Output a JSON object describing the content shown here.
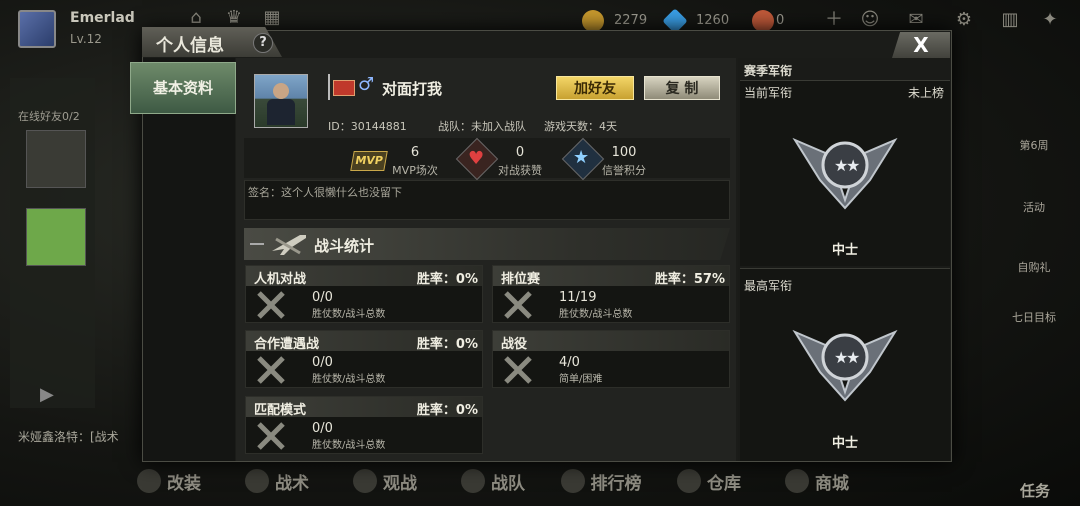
{
  "topbar": {
    "player_name": "Emerlad",
    "level": "Lv.12",
    "currency": [
      {
        "name": "gold",
        "value": "2279",
        "color": "#c99a2e"
      },
      {
        "name": "diamond",
        "value": "1260",
        "color": "#3aa0e8"
      },
      {
        "name": "medal",
        "value": "0",
        "color": "#c25a3a"
      }
    ]
  },
  "left_sidebar": {
    "online_friends": "在线好友0/2"
  },
  "chat": {
    "text": "米娅鑫洛特：[战术"
  },
  "right_sidebar": {
    "items": [
      "第6周",
      "活动",
      "自购礼",
      "七日目标"
    ]
  },
  "bottom_nav": [
    "改装",
    "战术",
    "观战",
    "战队",
    "排行榜",
    "仓库",
    "商城"
  ],
  "task_label": "任务",
  "panel": {
    "title": "个人信息",
    "help": "?",
    "close": "X",
    "tab_basic": "基本资料"
  },
  "profile": {
    "nickname": "对面打我",
    "gender_symbol": "♂",
    "add_friend": "加好友",
    "copy": "复 制",
    "id": "ID：30144881",
    "team": "战队：未加入战队",
    "days": "游戏天数：4天",
    "signature": "签名：这个人很懒什么也没留下"
  },
  "stats": [
    {
      "icon": "mvp-icon",
      "value": "6",
      "label": "MVP场次",
      "icon_text": "MVP"
    },
    {
      "icon": "heart-icon",
      "value": "0",
      "label": "对战获赞",
      "icon_text": "♥"
    },
    {
      "icon": "star-icon",
      "value": "100",
      "label": "信誉积分",
      "icon_text": "★"
    }
  ],
  "battle": {
    "title": "战斗统计",
    "modes": [
      {
        "name": "人机对战",
        "winrate": "胜率：0%",
        "value": "0/0",
        "label": "胜仗数/战斗总数"
      },
      {
        "name": "排位赛",
        "winrate": "胜率：57%",
        "value": "11/19",
        "label": "胜仗数/战斗总数"
      },
      {
        "name": "合作遭遇战",
        "winrate": "胜率：0%",
        "value": "0/0",
        "label": "胜仗数/战斗总数"
      },
      {
        "name": "战役",
        "winrate": "",
        "value": "4/0",
        "label": "简单/困难"
      },
      {
        "name": "匹配模式",
        "winrate": "胜率：0%",
        "value": "0/0",
        "label": "胜仗数/战斗总数"
      }
    ]
  },
  "season": {
    "title": "赛季军衔",
    "current_label": "当前军衔",
    "current_status": "未上榜",
    "current_rank": "中士",
    "highest_label": "最高军衔",
    "highest_rank": "中士"
  }
}
